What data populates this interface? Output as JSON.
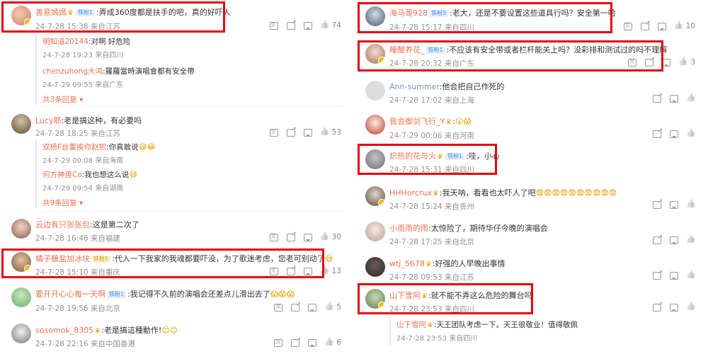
{
  "left": {
    "comments": [
      {
        "user": "善意嫣嫣",
        "badge": "铁粉1",
        "text": ":弄成360度都是扶手的吧，真的好吓人",
        "date": "24-7-28 15:38",
        "loc": "来自江苏",
        "likes": "74",
        "replies": [
          {
            "user": "明知道20144",
            "text": ":对啊 好危险",
            "date": "24-7-28 19:23",
            "loc": "来自四川"
          },
          {
            "user": "chenzuhong大鸿",
            "text": ":羅羅當時演唱會都有安全帶",
            "date": "24-7-29 09:55",
            "loc": "来自广东"
          }
        ],
        "more": "共3条回复"
      },
      {
        "user": "Lucy耶",
        "text": ":老是搞这种，有必要吗",
        "date": "24-7-28 18:25",
        "loc": "来自江苏",
        "likes": "53",
        "replies": [
          {
            "user": "双杨F丝藿挨你赵熙",
            "text": ":你真敢说",
            "date": "24-7-29 00:08",
            "loc": "来自海南"
          },
          {
            "user": "何方神兽Co",
            "text": ":我也想这么说",
            "date": "24-7-29 09:54",
            "loc": "来自湖南"
          }
        ],
        "more": "共9条回复"
      },
      {
        "user": "云边有只张张包",
        "text": ":这是第二次了",
        "date": "24-7-28 16:46",
        "loc": "来自福建",
        "likes": "30"
      },
      {
        "user": "橘子蘸盐加冰块",
        "badge": "铁粉5",
        "text": ":代入一下我家的我魂都要吓没，为了歌迷考虑，您老可别动了",
        "date": "24-7-28 15:10",
        "loc": "来自重庆",
        "likes": "13"
      },
      {
        "user": "要开开心心每一天啊",
        "badge": "铁粉1",
        "text": ":我记得不久前的演唱会还差点儿滑出去了",
        "date": "24-7-28 19:56",
        "loc": "来自北京",
        "likes": "5"
      },
      {
        "user": "sosomok_8305",
        "text": ":老是搞這種動作!",
        "date": "24-7-28 22:16",
        "loc": "来自中国香港",
        "likes": "6"
      }
    ]
  },
  "right": {
    "comments": [
      {
        "user": "海马哥928",
        "badge": "铁粉5",
        "text": ":老大，还是不要设置这些道具行吗？安全第一哈",
        "date": "24-7-28 15:17",
        "loc": "来自四川",
        "likes": "10"
      },
      {
        "user": "睡醒养花_",
        "badge": "铁粉1",
        "text": ":不应该有安全带或者栏杆能关上吗？没彩排和测试过的吗不理解",
        "date": "24-7-28 20:32",
        "loc": "来自广东",
        "likes": "3"
      },
      {
        "user": "Ann-summer",
        "text": ":他会把自己作死的",
        "date": "24-7-28 17:02",
        "loc": "来自上海"
      },
      {
        "user": "我会御剑飞行_Y",
        "text": ":",
        "date": "24-7-29 00:06",
        "loc": "来自河南"
      },
      {
        "user": "炽热的花与火",
        "badge": "铁粉1",
        "text": ":哇，小心",
        "date": "24-7-28 15:31",
        "loc": "来自四川"
      },
      {
        "user": "HHHorcrux",
        "text": ":我天呐，看看也太吓人了吧",
        "date": "24-7-28 15:24",
        "loc": "来自贵州"
      },
      {
        "user": "小雨雨的雨",
        "text": ":太惊险了，期待华仔今晚的演唱会",
        "date": "24-7-28 17:25",
        "loc": "来自北京"
      },
      {
        "user": "wtj_5678",
        "text": ":好强的人早晚出事情",
        "date": "24-7-28 09:53",
        "loc": "来自江苏"
      },
      {
        "user": "山下雪阿",
        "text": ":就不能不弄这么危险的舞台吗",
        "date": "24-7-28 23:53",
        "loc": "来自四川",
        "replies": [
          {
            "user": "山下雪阿",
            "text": ":天王团队考虑一下。天王很敬业！值得敬佩",
            "date": "24-7-28 23:53",
            "loc": "来自四川"
          }
        ]
      }
    ]
  },
  "colors": {
    "highlight": "#e60012",
    "username": "#eb7350",
    "meta": "#939393"
  }
}
